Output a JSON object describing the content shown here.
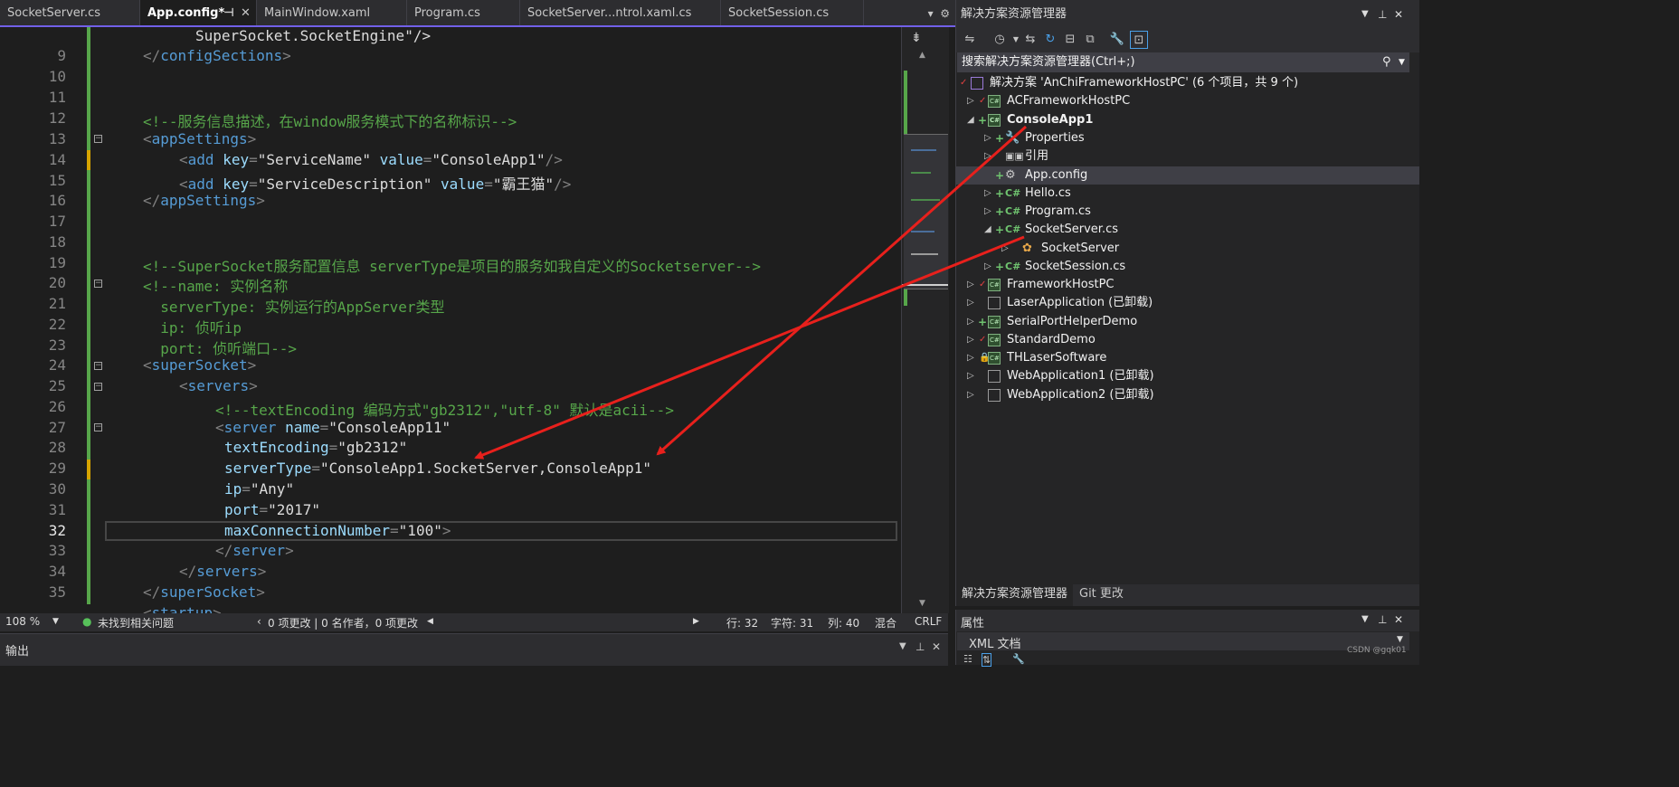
{
  "tabs": [
    {
      "label": "SocketServer.cs"
    },
    {
      "label": "App.config*"
    },
    {
      "label": "MainWindow.xaml"
    },
    {
      "label": "Program.cs"
    },
    {
      "label": "SocketServer...ntrol.xaml.cs"
    },
    {
      "label": "SocketSession.cs"
    }
  ],
  "active_tab_index": 1,
  "line_numbers": [
    "9",
    "10",
    "11",
    "12",
    "13",
    "14",
    "15",
    "16",
    "17",
    "18",
    "19",
    "20",
    "21",
    "22",
    "23",
    "24",
    "25",
    "26",
    "27",
    "28",
    "29",
    "30",
    "31",
    "32",
    "33",
    "34",
    "35"
  ],
  "code": {
    "l8": "SuperSocket.SocketEngine\"/>",
    "l9_tag": "configSections",
    "l12_com": "<!--服务信息描述，在window服务模式下的名称标识-->",
    "l13_tag": "appSettings",
    "l14_tag": "add",
    "l14_key_attr": "key",
    "l14_key": "\"ServiceName\"",
    "l14_val_attr": "value",
    "l14_val": "\"ConsoleApp1\"",
    "l15_tag": "add",
    "l15_key_attr": "key",
    "l15_key": "\"ServiceDescription\"",
    "l15_val_attr": "value",
    "l15_val": "\"霸王猫\"",
    "l16_tag": "appSettings",
    "l19_com": "<!--SuperSocket服务配置信息 serverType是项目的服务如我自定义的Socketserver-->",
    "l20_com": "<!--name: 实例名称",
    "l21_com": "  serverType: 实例运行的AppServer类型",
    "l22_com": "  ip: 侦听ip",
    "l23_com": "  port: 侦听端口-->",
    "l24_tag": "superSocket",
    "l25_tag": "servers",
    "l26_com": "<!--textEncoding 编码方式\"gb2312\",\"utf-8\" 默认是acii-->",
    "l27_tag": "server",
    "l27_attr": "name",
    "l27_val": "\"ConsoleApp11\"",
    "l28_attr": "textEncoding",
    "l28_val": "\"gb2312\"",
    "l29_attr": "serverType",
    "l29_val": "\"ConsoleApp1.SocketServer,ConsoleApp1\"",
    "l30_attr": "ip",
    "l30_val": "\"Any\"",
    "l31_attr": "port",
    "l31_val": "\"2017\"",
    "l32_attr": "maxConnectionNumber",
    "l32_val": "\"100\"",
    "l33_tag": "server",
    "l34_tag": "servers",
    "l35_tag": "superSocket",
    "l36_tag": "startup"
  },
  "status": {
    "zoom": "108 %",
    "issues": "未找到相关问题",
    "changes": "0 项更改 | 0 名作者，0 项更改",
    "line": "行: 32",
    "char": "字符: 31",
    "col": "列: 40",
    "mode": "混合",
    "eol": "CRLF"
  },
  "output_title": "输出",
  "solution_explorer": {
    "title": "解决方案资源管理器",
    "search_placeholder": "搜索解决方案资源管理器(Ctrl+;)",
    "solution": "解决方案 'AnChiFrameworkHostPC' (6 个项目，共 9 个)",
    "items": [
      {
        "label": "ACFrameworkHostPC"
      },
      {
        "label": "ConsoleApp1"
      },
      {
        "label": "Properties"
      },
      {
        "label": "引用"
      },
      {
        "label": "App.config"
      },
      {
        "label": "Hello.cs"
      },
      {
        "label": "Program.cs"
      },
      {
        "label": "SocketServer.cs"
      },
      {
        "label": "SocketServer"
      },
      {
        "label": "SocketSession.cs"
      },
      {
        "label": "FrameworkHostPC"
      },
      {
        "label": "LaserApplication (已卸载)"
      },
      {
        "label": "SerialPortHelperDemo"
      },
      {
        "label": "StandardDemo"
      },
      {
        "label": "THLaserSoftware"
      },
      {
        "label": "WebApplication1 (已卸载)"
      },
      {
        "label": "WebApplication2 (已卸载)"
      }
    ],
    "bottom_tabs": [
      "解决方案资源管理器",
      "Git 更改"
    ]
  },
  "properties": {
    "title": "属性",
    "object": "XML 文档"
  },
  "watermark": "CSDN @gqk01",
  "colors": {
    "accent": "#7160e8",
    "annotation_arrow": "#e8201c",
    "change_bar": "#57a64a"
  }
}
